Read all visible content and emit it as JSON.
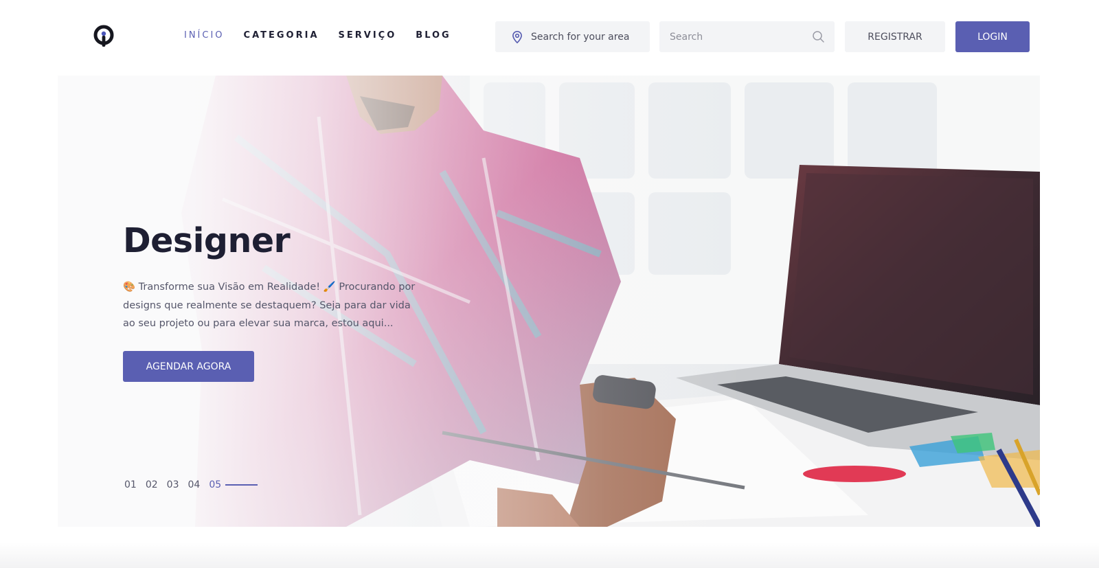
{
  "header": {
    "logo_icon": "keyhole-pin-logo",
    "nav": [
      {
        "label": "INÍCIO",
        "active": true
      },
      {
        "label": "CATEGORIA",
        "active": false
      },
      {
        "label": "SERVIÇO",
        "active": false
      },
      {
        "label": "BLOG",
        "active": false
      }
    ],
    "location": {
      "icon": "map-pin-icon",
      "label": "Search for your area"
    },
    "search": {
      "placeholder": "Search",
      "value": "",
      "icon": "search-icon"
    },
    "register_label": "REGISTRAR",
    "login_label": "LOGIN"
  },
  "hero": {
    "title": "Designer",
    "description": "🎨 Transforme sua Visão em Realidade! 🖌️ Procurando por designs que realmente se destaquem? Seja para dar vida ao seu projeto ou para elevar sua marca, estou aqui...",
    "cta_label": "AGENDAR AGORA",
    "slides": [
      "01",
      "02",
      "03",
      "04",
      "05"
    ],
    "active_slide": "05"
  },
  "colors": {
    "accent": "#5a5fb2",
    "text_dark": "#1e1f33",
    "text_muted": "#55566a",
    "input_bg": "#f3f4f6"
  }
}
